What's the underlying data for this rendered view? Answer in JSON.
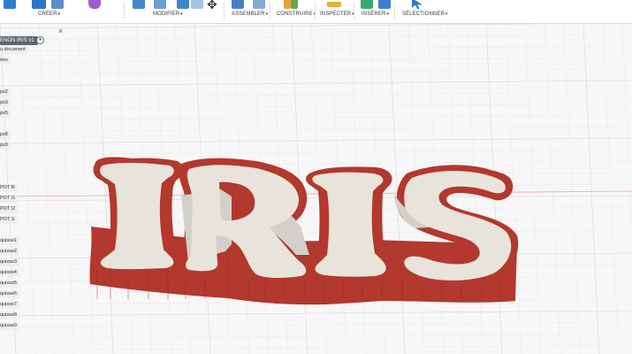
{
  "toolbar": {
    "groups": [
      {
        "label": "CRÉER",
        "caret": "▾"
      },
      {
        "label": "MODIFIER",
        "caret": "▾"
      },
      {
        "label": "ASSEMBLER",
        "caret": "▾"
      },
      {
        "label": "CONSTRUIRE",
        "caret": "▾"
      },
      {
        "label": "INSPECTER",
        "caret": "▾"
      },
      {
        "label": "INSÉRER",
        "caret": "▾"
      },
      {
        "label": "SÉLECTIONNER",
        "caret": "▾"
      }
    ],
    "icons": [
      {
        "name": "sketch-icon",
        "color": "#2d7fd1"
      },
      {
        "name": "extrude-icon",
        "color": "#2b74c4"
      },
      {
        "name": "revolve-icon",
        "color": "#5a8fc8"
      },
      {
        "name": "form-icon",
        "color": "#9b5fd4"
      },
      {
        "name": "press-pull-icon",
        "color": "#3f86cc"
      },
      {
        "name": "fillet-icon",
        "color": "#6e9fd0"
      },
      {
        "name": "chamfer-icon",
        "color": "#3f86cc"
      },
      {
        "name": "move-icon",
        "color": "#333333"
      },
      {
        "name": "new-component-icon",
        "color": "#4a7fc2"
      },
      {
        "name": "joint-icon",
        "color": "#86a9d1"
      },
      {
        "name": "offset-plane-icon",
        "color": "#e0a43a"
      },
      {
        "name": "axis-icon",
        "color": "#6aa84f"
      },
      {
        "name": "measure-icon",
        "color": "#e3b23c"
      },
      {
        "name": "insert-derive-icon",
        "color": "#3aa86a"
      },
      {
        "name": "insert-image-icon",
        "color": "#3d7ed0"
      },
      {
        "name": "select-icon",
        "color": "#2f78cf"
      }
    ]
  },
  "browser": {
    "root_label": "ENON IRIS v1",
    "root_button": "●",
    "close_icon": "×",
    "items": [
      "u document",
      "ées",
      "ps2",
      "ps3",
      "ps5",
      "ps8",
      "ps9",
      "POT R",
      "POT I1",
      "POT I2",
      "POT S",
      "quisse1",
      "quisse2",
      "quisse3",
      "quisse4",
      "quisse5",
      "quisse6",
      "quisse7",
      "quisse8",
      "quisse9"
    ]
  },
  "model": {
    "letters": [
      "I",
      "R",
      "I",
      "S"
    ],
    "wall_color": "#b3382d",
    "wall_dark": "#8f2a22",
    "face_color": "#e8e4dc",
    "floor_color": "#d3d0c9"
  },
  "colors": {
    "grid_major": "#d9d9de",
    "grid_minor": "#ebebee",
    "axis_red": "#e8a9a9",
    "background": "#f7f7f8"
  }
}
